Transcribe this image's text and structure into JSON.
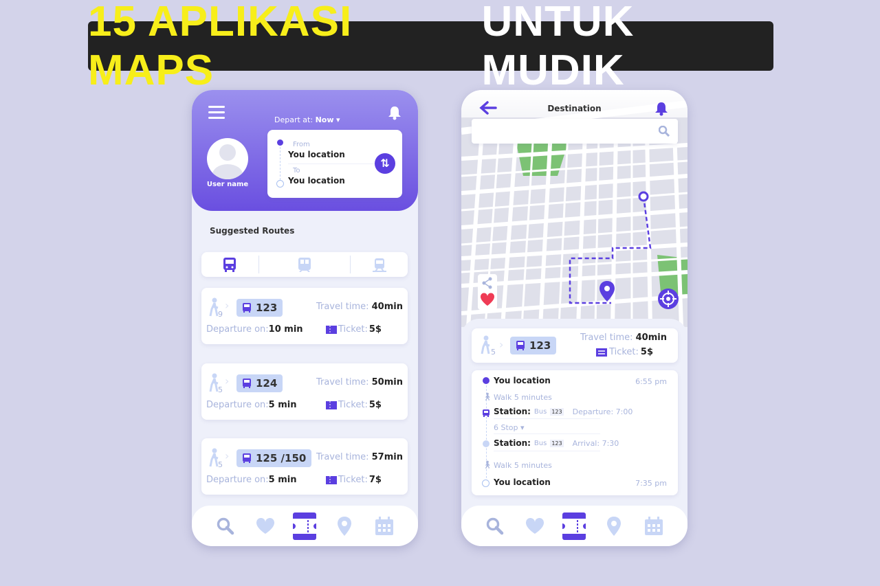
{
  "banner": {
    "highlight": "15 APLIKASI MAPS",
    "rest": "UNTUK MUDIK"
  },
  "left_phone": {
    "depart_label": "Depart at:",
    "depart_value": "Now",
    "user_name": "User name",
    "from_label": "From",
    "from_value": "You location",
    "to_label": "To",
    "to_value": "You location",
    "section_title": "Suggested Routes",
    "transport_tabs": [
      "bus-icon",
      "metro-icon",
      "train-icon"
    ],
    "routes": [
      {
        "walk": "9",
        "bus": "123",
        "travel_label": "Travel time:",
        "travel": "40min",
        "dep_label": "Departure on:",
        "dep": "10 min",
        "ticket_label": "Ticket:",
        "ticket": "5$"
      },
      {
        "walk": "5",
        "bus": "124",
        "travel_label": "Travel time:",
        "travel": "50min",
        "dep_label": "Departure on:",
        "dep": "5 min",
        "ticket_label": "Ticket:",
        "ticket": "5$"
      },
      {
        "walk": "5",
        "bus": "125 /150",
        "travel_label": "Travel time:",
        "travel": "57min",
        "dep_label": "Departure on:",
        "dep": "5 min",
        "ticket_label": "Ticket:",
        "ticket": "7$"
      }
    ]
  },
  "right_phone": {
    "title": "Destination",
    "search_placeholder": "",
    "summary": {
      "walk": "5",
      "bus": "123",
      "travel_label": "Travel time:",
      "travel": "40min",
      "ticket_label": "Ticket:",
      "ticket": "5$"
    },
    "steps": {
      "start": "You location",
      "start_time": "6:55 pm",
      "walk1": "Walk 5 minutes",
      "station1_label": "Station:",
      "station1_bus": "Bus",
      "station1_num": "123",
      "station1_info": "Departure: 7:00",
      "stops": "6 Stop",
      "station2_label": "Station:",
      "station2_bus": "Bus",
      "station2_num": "123",
      "station2_info": "Arrival: 7:30",
      "walk2": "Walk 5 minutes",
      "end": "You location",
      "end_time": "7:35 pm"
    }
  },
  "nav_items": [
    "search-icon",
    "heart-icon",
    "ticket-icon",
    "location-pin-icon",
    "calendar-icon"
  ],
  "colors": {
    "accent": "#5b3fe0",
    "light_accent": "#c8d6f6",
    "muted": "#a8b4dc",
    "banner_yellow": "#f7ee1a",
    "park": "#7cc274",
    "fav": "#ef3b55"
  }
}
